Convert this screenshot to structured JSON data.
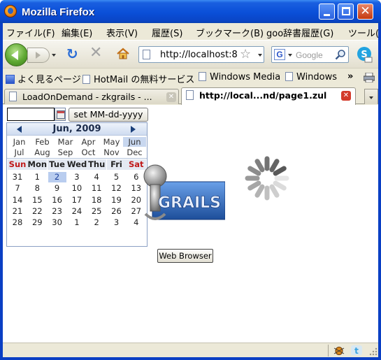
{
  "window": {
    "title": "Mozilla Firefox"
  },
  "menubar": {
    "items": [
      {
        "label": "ファイル(F)"
      },
      {
        "label": "編集(E)"
      },
      {
        "label": "表示(V)"
      },
      {
        "label": "履歴(S)"
      },
      {
        "label": "ブックマーク(B)"
      },
      {
        "label": "goo辞書履歴(G)"
      },
      {
        "label": "ツール("
      }
    ]
  },
  "navbar": {
    "url": "http://localhost:8",
    "search_placeholder": "Google"
  },
  "bookmarks": {
    "items": [
      {
        "label": "よく見るページ"
      },
      {
        "label": "HotMail の無料サービス"
      },
      {
        "label": "Windows Media"
      },
      {
        "label": "Windows"
      }
    ],
    "overflow": "»"
  },
  "tabs": [
    {
      "label": "LoadOnDemand - zkgrails - ...",
      "active": false
    },
    {
      "label": "http://local...nd/page1.zul",
      "active": true
    }
  ],
  "datebox": {
    "value": "",
    "set_button": "set MM-dd-yyyy"
  },
  "calendar": {
    "title": "Jun, 2009",
    "months": [
      "Jan",
      "Feb",
      "Mar",
      "Apr",
      "May",
      "Jun",
      "Jul",
      "Aug",
      "Sep",
      "Oct",
      "Nov",
      "Dec"
    ],
    "selected_month": "Jun",
    "weekdays": [
      "Sun",
      "Mon",
      "Tue",
      "Wed",
      "Thu",
      "Fri",
      "Sat"
    ],
    "weeks": [
      [
        "31",
        "1",
        "2",
        "3",
        "4",
        "5",
        "6"
      ],
      [
        "7",
        "8",
        "9",
        "10",
        "11",
        "12",
        "13"
      ],
      [
        "14",
        "15",
        "16",
        "17",
        "18",
        "19",
        "20"
      ],
      [
        "21",
        "22",
        "23",
        "24",
        "25",
        "26",
        "27"
      ],
      [
        "28",
        "29",
        "30",
        "1",
        "2",
        "3",
        "4"
      ]
    ],
    "selected_day": "2"
  },
  "logo": {
    "text": "GRAILS"
  },
  "web_browser_button": "Web Browser",
  "colors": {
    "titlebar": "#0a4fd8",
    "calendar_weekend": "#c01818",
    "calendar_selected": "#b9cdef"
  }
}
